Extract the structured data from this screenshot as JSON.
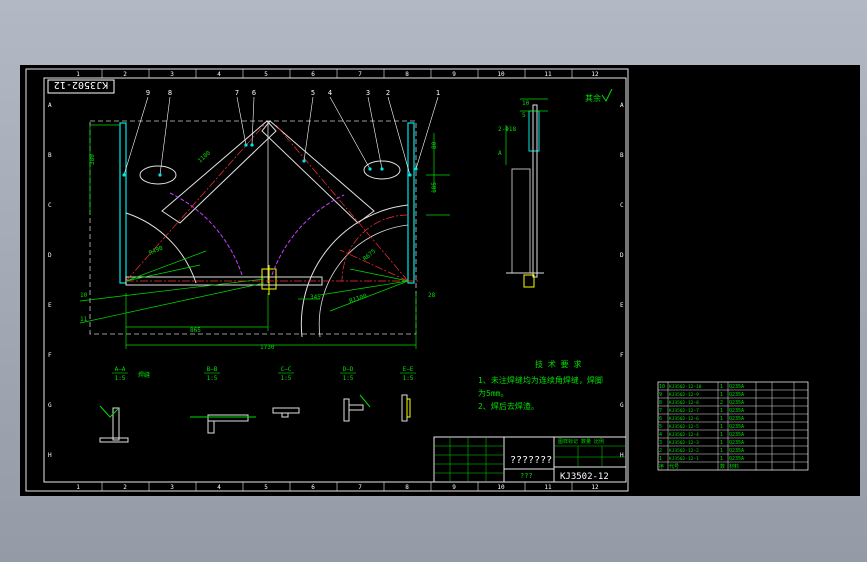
{
  "colors": {
    "frame": "#e8e8e8",
    "part": "#00e5e5",
    "dim": "#00dd00",
    "hidden": "#ff3030",
    "arc": "#c040ff",
    "white": "#ffffff",
    "yellow": "#ffff00"
  },
  "columns": [
    "1",
    "2",
    "3",
    "4",
    "5",
    "6",
    "7",
    "8",
    "9",
    "10",
    "11",
    "12"
  ],
  "rows": [
    "A",
    "B",
    "C",
    "D",
    "E",
    "F",
    "G",
    "H"
  ],
  "drawing_code_top": "KJ3502-12",
  "balloons": [
    "9",
    "8",
    "7",
    "6",
    "5",
    "4",
    "3",
    "2",
    "1"
  ],
  "dimensions": [
    "1730",
    "865",
    "380",
    "80",
    "185",
    "1100",
    "345",
    "28",
    "10",
    "R490",
    "R1100",
    "R675"
  ],
  "weld_marks": [
    "10",
    "11"
  ],
  "section_labels": [
    {
      "name": "A—A",
      "scale": "1:5",
      "note": "焊缝"
    },
    {
      "name": "B—B",
      "scale": "1:5",
      "note": ""
    },
    {
      "name": "C—C",
      "scale": "1:5",
      "note": ""
    },
    {
      "name": "D—D",
      "scale": "1:5",
      "note": ""
    },
    {
      "name": "E—E",
      "scale": "1:5",
      "note": ""
    }
  ],
  "surface_mark": "其余",
  "tech_req": {
    "title": "技 术 要 求",
    "line1": "1、未注焊缝均为连续角焊缝，焊脚",
    "line2": "为5mm。",
    "line3": "2、焊后去焊渣。"
  },
  "title_block": {
    "unit": "???????",
    "name_label": "???",
    "drawing_code": "KJ3502-12",
    "hdr": "图样标记 数量 比例"
  },
  "bom_rows": [
    {
      "no": "10",
      "code": "KJ3502-12-10",
      "qty": "1",
      "mat": "Q235A"
    },
    {
      "no": "9",
      "code": "KJ3502-12-9",
      "qty": "1",
      "mat": "Q235A"
    },
    {
      "no": "8",
      "code": "KJ3502-12-8",
      "qty": "2",
      "mat": "Q235A"
    },
    {
      "no": "7",
      "code": "KJ3502-12-7",
      "qty": "1",
      "mat": "Q235A"
    },
    {
      "no": "6",
      "code": "KJ3502-12-6",
      "qty": "1",
      "mat": "Q235A"
    },
    {
      "no": "5",
      "code": "KJ3502-12-5",
      "qty": "1",
      "mat": "Q235A"
    },
    {
      "no": "4",
      "code": "KJ3502-12-4",
      "qty": "1",
      "mat": "Q235A"
    },
    {
      "no": "3",
      "code": "KJ3502-12-3",
      "qty": "1",
      "mat": "Q235A"
    },
    {
      "no": "2",
      "code": "KJ3502-12-2",
      "qty": "1",
      "mat": "Q235A"
    },
    {
      "no": "1",
      "code": "KJ3502-12-1",
      "qty": "1",
      "mat": "Q235A"
    }
  ],
  "bom_header": {
    "no": "序",
    "code": "代号",
    "qty": "数",
    "mat": "材料"
  }
}
